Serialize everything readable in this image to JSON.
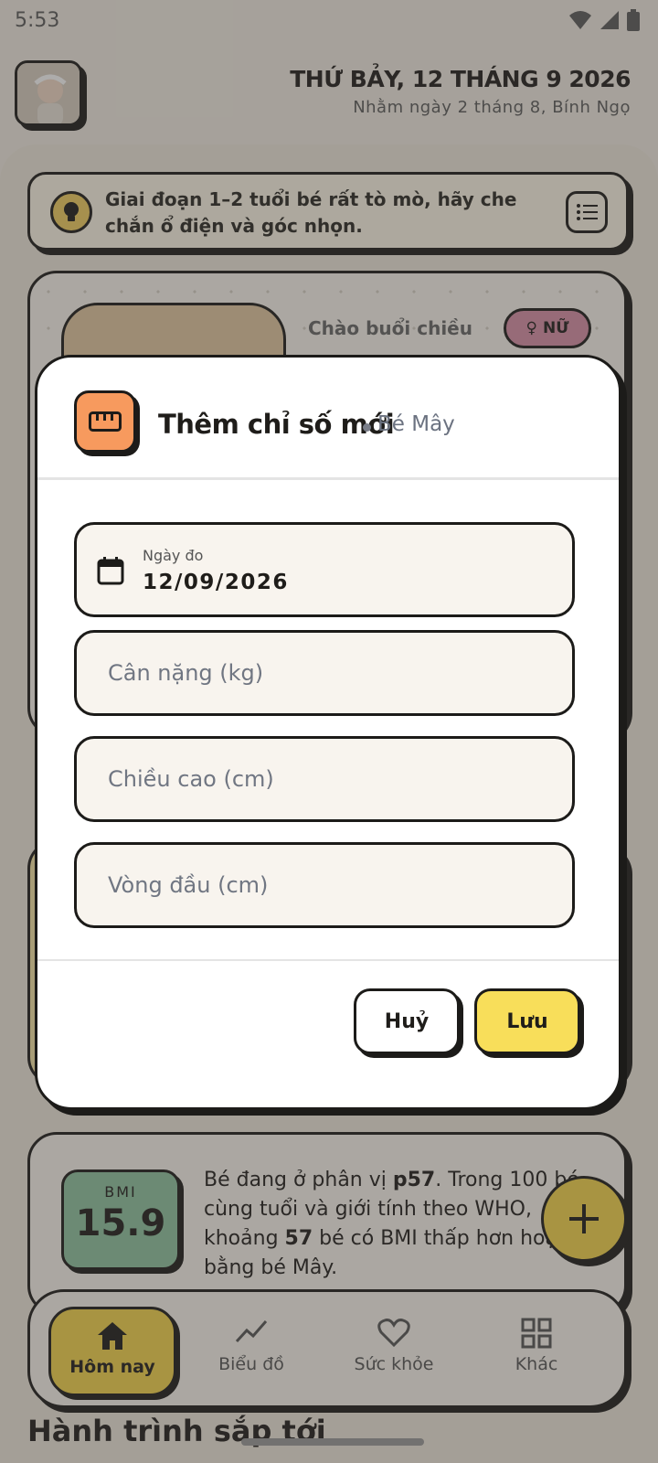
{
  "status_bar": {
    "time": "5:53"
  },
  "header": {
    "date": "THỨ BẢY, 12 THÁNG 9 2026",
    "lunar": "Nhằm ngày 2 tháng 8, Bính Ngọ"
  },
  "tip": {
    "text": "Giai đoạn 1–2 tuổi bé rất tò mò, hãy che chắn ổ điện và góc nhọn."
  },
  "profile": {
    "greeting": "Chào buổi chiều",
    "gender": "NỮ"
  },
  "bmi": {
    "label": "BMI",
    "value": "15.9",
    "text_1": "Bé đang ở phân vị ",
    "percentile": "p57",
    "text_2": ". Trong 100 bé cùng tuổi và giới tính theo WHO, khoảng ",
    "count": "57",
    "text_3": " bé có BMI thấp hơn hoặc bằng bé Mây."
  },
  "nav": {
    "items": [
      {
        "label": "Hôm nay",
        "icon": "home-icon",
        "active": true
      },
      {
        "label": "Biểu đồ",
        "icon": "chart-icon",
        "active": false
      },
      {
        "label": "Sức khỏe",
        "icon": "heart-icon",
        "active": false
      },
      {
        "label": "Khác",
        "icon": "grid-icon",
        "active": false
      }
    ]
  },
  "journey": {
    "title": "Hành trình sắp tới"
  },
  "dialog": {
    "icon": "ruler-icon",
    "title": "Thêm chỉ số mới",
    "subtitle": "Bé Mây",
    "date_label": "Ngày đo",
    "date_value": "12/09/2026",
    "weight_placeholder": "Cân nặng (kg)",
    "height_placeholder": "Chiều cao (cm)",
    "head_placeholder": "Vòng đầu (cm)",
    "cancel": "Huỷ",
    "save": "Lưu"
  },
  "colors": {
    "accent_yellow": "#f8de5a",
    "dialog_icon_orange": "#f79a5e",
    "bmi_green": "#8fc4a1",
    "gender_pink": "#d98fa7"
  }
}
